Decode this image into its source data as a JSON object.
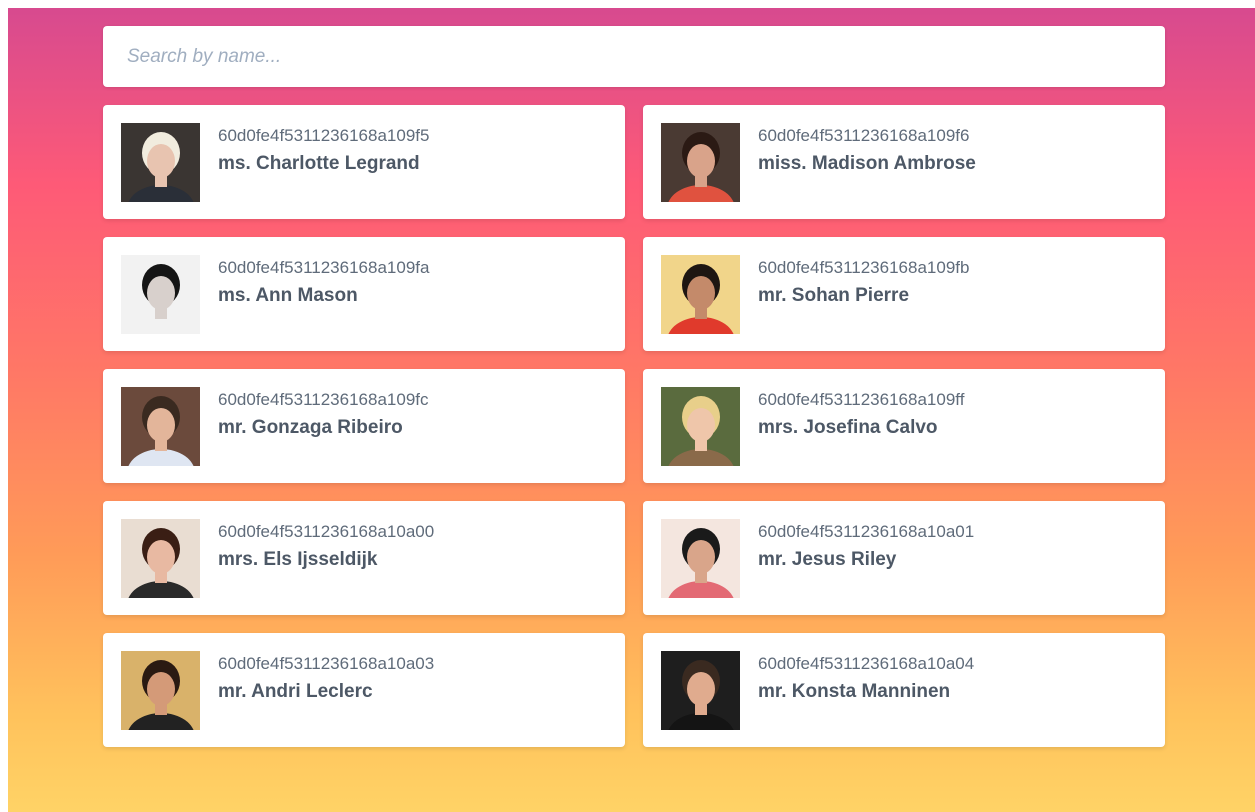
{
  "search": {
    "placeholder": "Search by name...",
    "value": ""
  },
  "users": [
    {
      "id": "60d0fe4f5311236168a109f5",
      "name": "ms. Charlotte Legrand",
      "avatar": {
        "bg": "#3a3532",
        "skin": "#e8c4b0",
        "hair": "#f1ecde",
        "shirt": "#2a2f38"
      }
    },
    {
      "id": "60d0fe4f5311236168a109f6",
      "name": "miss. Madison Ambrose",
      "avatar": {
        "bg": "#4a3a33",
        "skin": "#d9a38a",
        "hair": "#2b1a14",
        "shirt": "#e0523f"
      }
    },
    {
      "id": "60d0fe4f5311236168a109fa",
      "name": "ms. Ann Mason",
      "avatar": {
        "bg": "#f2f2f2",
        "skin": "#d8d0cc",
        "hair": "#151515",
        "shirt": "#f2f2f2"
      }
    },
    {
      "id": "60d0fe4f5311236168a109fb",
      "name": "mr. Sohan Pierre",
      "avatar": {
        "bg": "#f1d58a",
        "skin": "#c48a6a",
        "hair": "#1e1612",
        "shirt": "#e03a2c"
      }
    },
    {
      "id": "60d0fe4f5311236168a109fc",
      "name": "mr. Gonzaga Ribeiro",
      "avatar": {
        "bg": "#6b4a3c",
        "skin": "#e3b59a",
        "hair": "#3a2a20",
        "shirt": "#dfe6f2"
      }
    },
    {
      "id": "60d0fe4f5311236168a109ff",
      "name": "mrs. Josefina Calvo",
      "avatar": {
        "bg": "#5a6b3e",
        "skin": "#efc6aa",
        "hair": "#e8cf8a",
        "shirt": "#8a6a4a"
      }
    },
    {
      "id": "60d0fe4f5311236168a10a00",
      "name": "mrs. Els Ijsseldijk",
      "avatar": {
        "bg": "#e9ddd2",
        "skin": "#e8b9a2",
        "hair": "#3a1e14",
        "shirt": "#2a2a2a"
      }
    },
    {
      "id": "60d0fe4f5311236168a10a01",
      "name": "mr. Jesus Riley",
      "avatar": {
        "bg": "#f4e6df",
        "skin": "#d9a58a",
        "hair": "#1a1a1a",
        "shirt": "#e36a74"
      }
    },
    {
      "id": "60d0fe4f5311236168a10a03",
      "name": "mr. Andri Leclerc",
      "avatar": {
        "bg": "#d9b26a",
        "skin": "#d49a78",
        "hair": "#2a1a12",
        "shirt": "#222222"
      }
    },
    {
      "id": "60d0fe4f5311236168a10a04",
      "name": "mr. Konsta Manninen",
      "avatar": {
        "bg": "#1e1e1e",
        "skin": "#e0ab8e",
        "hair": "#3a2a20",
        "shirt": "#141414"
      }
    }
  ]
}
